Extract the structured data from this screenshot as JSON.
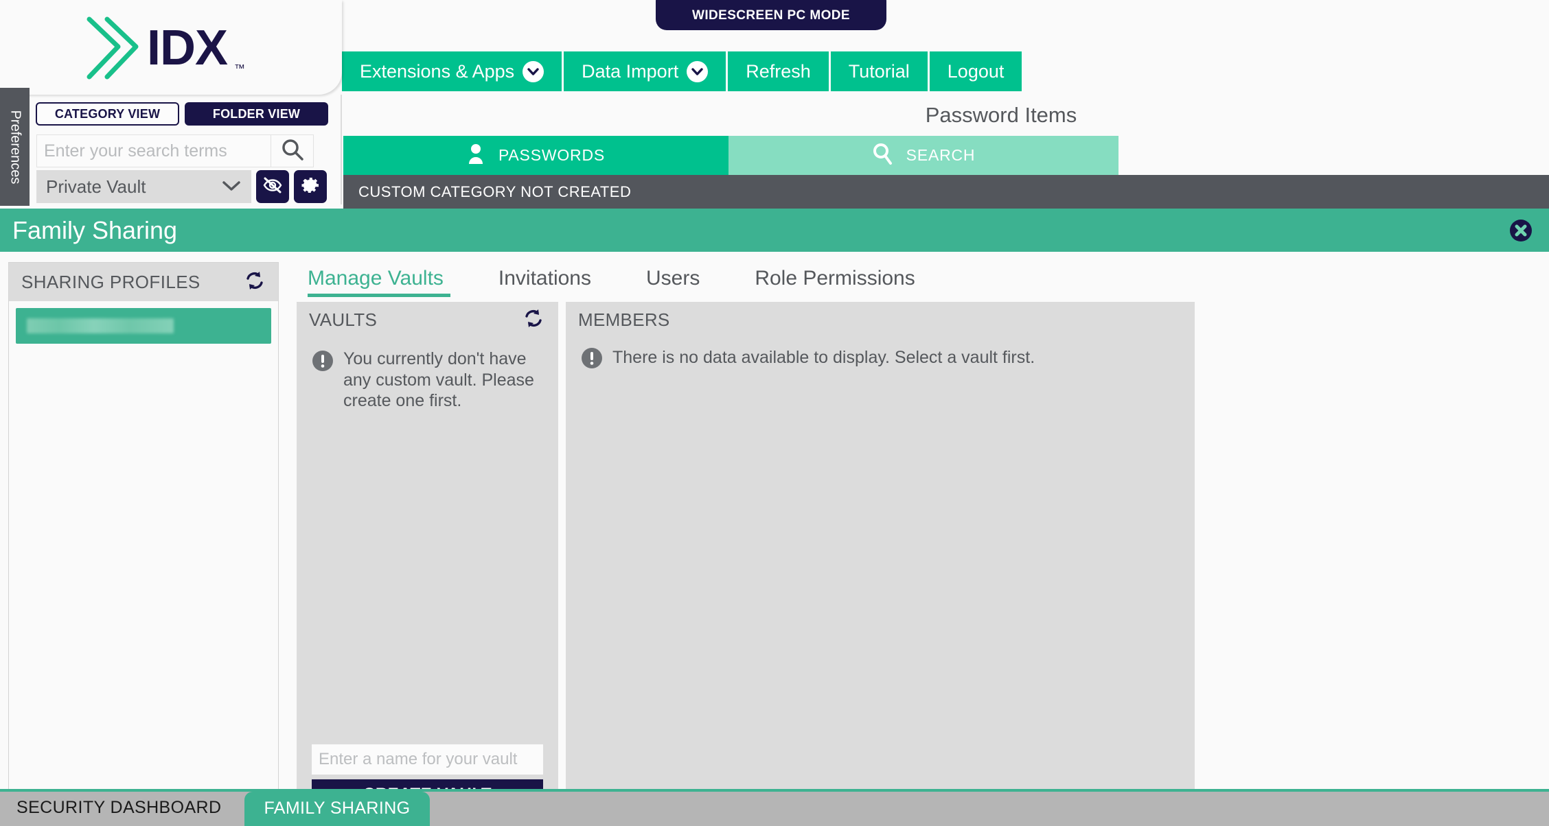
{
  "brand": {
    "logo_text": "IDX",
    "logo_tm": "™",
    "logo_icon": "idx-chevron-logo"
  },
  "widescreen_badge": {
    "label": "WIDESCREEN PC MODE"
  },
  "topnav": {
    "items": [
      {
        "label": "Extensions & Apps",
        "has_dropdown": true
      },
      {
        "label": "Data Import",
        "has_dropdown": true
      },
      {
        "label": "Refresh",
        "has_dropdown": false
      },
      {
        "label": "Tutorial",
        "has_dropdown": false
      },
      {
        "label": "Logout",
        "has_dropdown": false
      }
    ]
  },
  "left_panel": {
    "preferences_tab": "Preferences",
    "view_toggle": {
      "category_view": "CATEGORY VIEW",
      "folder_view": "FOLDER VIEW",
      "active": "FOLDER VIEW"
    },
    "search": {
      "placeholder": "Enter your search terms",
      "value": "",
      "icon": "search-icon"
    },
    "vault_selector": {
      "value": "Private Vault",
      "chevron": "chevron-down-icon"
    },
    "buttons": [
      {
        "icon": "eye-slash-icon"
      },
      {
        "icon": "gear-icon"
      }
    ]
  },
  "content_header": {
    "title": "Password Items",
    "tabs": [
      {
        "label": "PASSWORDS",
        "icon": "person-icon",
        "active": true
      },
      {
        "label": "SEARCH",
        "icon": "search-icon",
        "active": false
      }
    ],
    "category_bar": "CUSTOM CATEGORY NOT CREATED"
  },
  "family_sharing": {
    "title": "Family Sharing",
    "close_icon": "close-circle-icon",
    "tabs": [
      {
        "label": "Manage Vaults",
        "active": true
      },
      {
        "label": "Invitations",
        "active": false
      },
      {
        "label": "Users",
        "active": false
      },
      {
        "label": "Role Permissions",
        "active": false
      }
    ],
    "sharing_profiles": {
      "heading": "SHARING PROFILES",
      "refresh_icon": "refresh-icon",
      "items": [
        {
          "label": "",
          "redacted": true
        }
      ]
    },
    "vaults": {
      "heading": "VAULTS",
      "refresh_icon": "refresh-icon",
      "empty_message": "You currently don't have any custom vault. Please create one first.",
      "message_icon": "exclamation-icon",
      "name_input_placeholder": "Enter a name for your vault",
      "name_input_value": "",
      "create_button": "CREATE VAULT"
    },
    "members": {
      "heading": "MEMBERS",
      "empty_message": "There is no data available to display. Select a vault first.",
      "message_icon": "exclamation-icon"
    },
    "bottom_bar": {
      "security_dashboard": "SECURITY DASHBOARD",
      "family_sharing": "FAMILY SHARING",
      "active": "FAMILY SHARING"
    }
  },
  "colors": {
    "brand_green": "#00c18e",
    "brand_navy": "#191447",
    "panel_green": "#3db291",
    "tab_green_light": "#86ddc1",
    "gray_bar": "#53565c",
    "card_gray": "#dcdcdc"
  }
}
